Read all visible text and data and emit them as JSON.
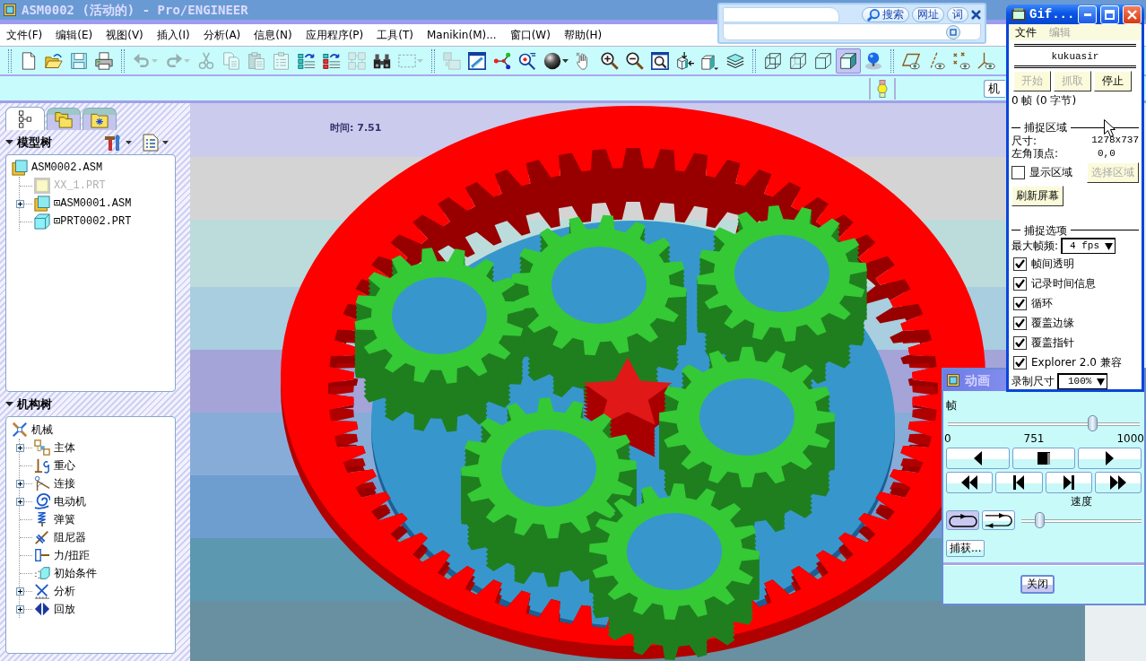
{
  "window": {
    "title": "ASM0002 (活动的) - Pro/ENGINEER"
  },
  "menu": [
    "文件(F)",
    "编辑(E)",
    "视图(V)",
    "插入(I)",
    "分析(A)",
    "信息(N)",
    "应用程序(P)",
    "工具(T)",
    "Manikin(M)...",
    "窗口(W)",
    "帮助(H)"
  ],
  "toolbar": [
    [
      {
        "kind": "new",
        "disabled": false
      },
      {
        "kind": "open",
        "disabled": false
      },
      {
        "kind": "save",
        "disabled": false
      },
      {
        "kind": "print",
        "disabled": false
      }
    ],
    [
      {
        "kind": "undo",
        "disabled": true,
        "dropdown": true
      },
      {
        "kind": "redo",
        "disabled": true,
        "dropdown": true
      },
      {
        "kind": "cut",
        "disabled": true
      },
      {
        "kind": "copy",
        "disabled": true
      },
      {
        "kind": "paste",
        "disabled": true
      },
      {
        "kind": "paste-special",
        "disabled": true
      },
      {
        "kind": "regenerate",
        "disabled": false
      },
      {
        "kind": "regen-manager",
        "disabled": false
      },
      {
        "kind": "pattern-grid",
        "disabled": true
      },
      {
        "kind": "find",
        "disabled": false
      },
      {
        "kind": "select-box",
        "disabled": true,
        "dropdown": true
      }
    ],
    [
      {
        "kind": "component-display",
        "disabled": true
      },
      {
        "kind": "view-window",
        "disabled": false
      },
      {
        "kind": "connectors",
        "disabled": false
      },
      {
        "kind": "spin-center",
        "disabled": false
      },
      {
        "kind": "sphere",
        "disabled": false,
        "dropdown": true
      },
      {
        "kind": "pan",
        "disabled": false
      },
      {
        "kind": "zoom-in",
        "disabled": false
      },
      {
        "kind": "zoom-out",
        "disabled": false
      },
      {
        "kind": "refit",
        "disabled": false
      },
      {
        "kind": "reorient",
        "disabled": false
      },
      {
        "kind": "saved-views",
        "disabled": false
      },
      {
        "kind": "layers",
        "disabled": false
      }
    ],
    [
      {
        "kind": "wireframe",
        "disabled": false,
        "selected": false
      },
      {
        "kind": "hidden-line",
        "disabled": false,
        "selected": false
      },
      {
        "kind": "no-hidden",
        "disabled": false,
        "selected": false
      },
      {
        "kind": "shading",
        "disabled": false,
        "selected": true
      },
      {
        "kind": "light-sphere",
        "disabled": false,
        "selected": false
      }
    ],
    [
      {
        "kind": "datum-planes",
        "disabled": false
      },
      {
        "kind": "datum-axes",
        "disabled": false
      },
      {
        "kind": "datum-points",
        "disabled": false
      },
      {
        "kind": "csys",
        "disabled": false
      }
    ]
  ],
  "toolbar_row_2": {
    "mode_button": "机"
  },
  "navigator_tabs": [
    {
      "kind": "model-tree",
      "selected": true
    },
    {
      "kind": "folders",
      "selected": false
    },
    {
      "kind": "favorites",
      "selected": false
    }
  ],
  "model_tree": {
    "title": "模型树",
    "items": [
      {
        "label": "ASM0002.ASM",
        "kind": "assembly",
        "disabled": false,
        "children": [
          {
            "label": "XX_1.PRT",
            "kind": "part",
            "disabled": true
          },
          {
            "label": "⊡ASM0001.ASM",
            "kind": "assembly",
            "disabled": false,
            "expanded": false
          },
          {
            "label": "⊡PRT0002.PRT",
            "kind": "part",
            "disabled": false
          }
        ]
      }
    ]
  },
  "mechanism_tree": {
    "title": "机构树",
    "items": [
      {
        "label": "机械",
        "kind": "mechanism",
        "children": [
          {
            "label": "主体",
            "kind": "bodies",
            "expanded": false
          },
          {
            "label": "重心",
            "kind": "gravity"
          },
          {
            "label": "连接",
            "kind": "connections",
            "expanded": false
          },
          {
            "label": "电动机",
            "kind": "motors",
            "expanded": false
          },
          {
            "label": "弹簧",
            "kind": "springs"
          },
          {
            "label": "阻尼器",
            "kind": "dampers"
          },
          {
            "label": "力/扭距",
            "kind": "forces"
          },
          {
            "label": "初始条件",
            "kind": "initial-conditions"
          },
          {
            "label": "分析",
            "kind": "analyses",
            "expanded": false
          },
          {
            "label": "回放",
            "kind": "playbacks",
            "expanded": false
          }
        ]
      }
    ]
  },
  "viewport": {
    "readout": "时间: 7.51"
  },
  "search_bar": {
    "search_button": "搜索",
    "url_button": "网址",
    "word_button": "词"
  },
  "gif_recorder": {
    "title": "Gif...",
    "menu": [
      {
        "label": "文件",
        "disabled": false
      },
      {
        "label": "编辑",
        "disabled": true
      }
    ],
    "author": "kukuasir",
    "buttons": [
      {
        "label": "开始",
        "disabled": true
      },
      {
        "label": "抓取",
        "disabled": true
      },
      {
        "label": "停止",
        "disabled": false
      }
    ],
    "status": "0 帧 (0 字节)",
    "capture_area": {
      "heading": "捕捉区域",
      "size_label": "尺寸:",
      "size_value": "1278x737",
      "origin_label": "左角顶点:",
      "origin_value": "0,0",
      "show_area": {
        "label": "显示区域",
        "checked": false
      },
      "select_button": {
        "label": "选择区域",
        "disabled": true
      },
      "refresh_button": "刷新屏幕"
    },
    "capture_options": {
      "heading": "捕捉选项",
      "max_rate_label": "最大帧频:",
      "max_rate_value": "4 fps",
      "options": [
        {
          "label": "帧间透明",
          "checked": true
        },
        {
          "label": "记录时间信息",
          "checked": true
        },
        {
          "label": "循环",
          "checked": true
        },
        {
          "label": "覆盖边缘",
          "checked": true
        },
        {
          "label": "覆盖指针",
          "checked": true
        },
        {
          "label": "Explorer 2.0 兼容",
          "checked": true
        }
      ],
      "record_size_label": "录制尺寸",
      "record_size_value": "100%"
    }
  },
  "animation_dialog": {
    "title": "动画",
    "frame_label": "帧",
    "frame_slider": {
      "level": 0.751
    },
    "frame_ticks": [
      "0",
      "751",
      "1000"
    ],
    "transport_buttons": [
      {
        "kind": "play-backward"
      },
      {
        "kind": "stop"
      },
      {
        "kind": "play-forward"
      }
    ],
    "step_buttons": [
      {
        "kind": "rewind"
      },
      {
        "kind": "step-backward"
      },
      {
        "kind": "step-forward"
      },
      {
        "kind": "fast-forward"
      }
    ],
    "speed_label": "速度",
    "loop_modes": [
      {
        "kind": "repeat",
        "selected": true
      },
      {
        "kind": "bounce",
        "selected": false
      }
    ],
    "speed_slider": {
      "level": 0.15
    },
    "capture_button": "捕获...",
    "close_button": "关闭"
  }
}
